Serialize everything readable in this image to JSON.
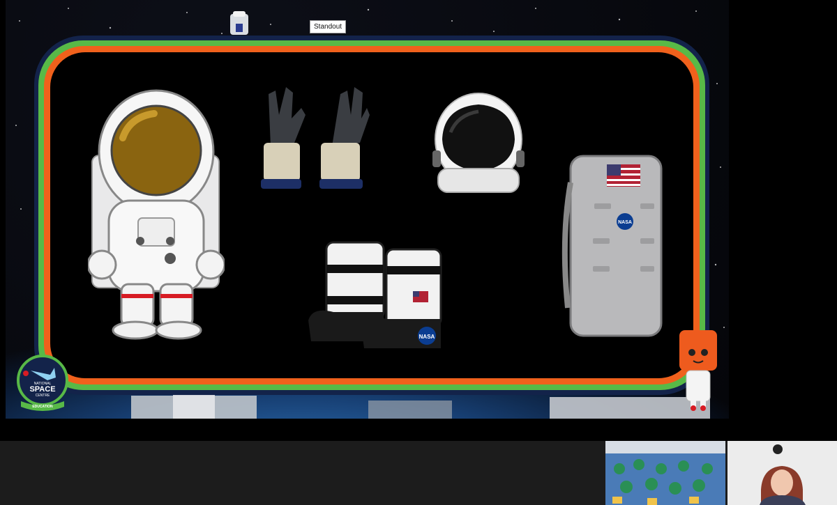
{
  "tooltip": {
    "text": "Standout"
  },
  "logo": {
    "line1": "NATIONAL",
    "line2": "SPACE",
    "line3": "CENTRE",
    "ribbon": "EDUCATION"
  },
  "items": [
    {
      "name": "astronaut-cartoon"
    },
    {
      "name": "spacesuit-gloves"
    },
    {
      "name": "space-helmet"
    },
    {
      "name": "space-boots",
      "badge": "NASA"
    },
    {
      "name": "life-support-backpack",
      "badge": "NASA"
    }
  ],
  "colors": {
    "frame_navy": "#13234a",
    "frame_green": "#58b947",
    "frame_orange": "#f0611c",
    "panel": "#000000"
  }
}
